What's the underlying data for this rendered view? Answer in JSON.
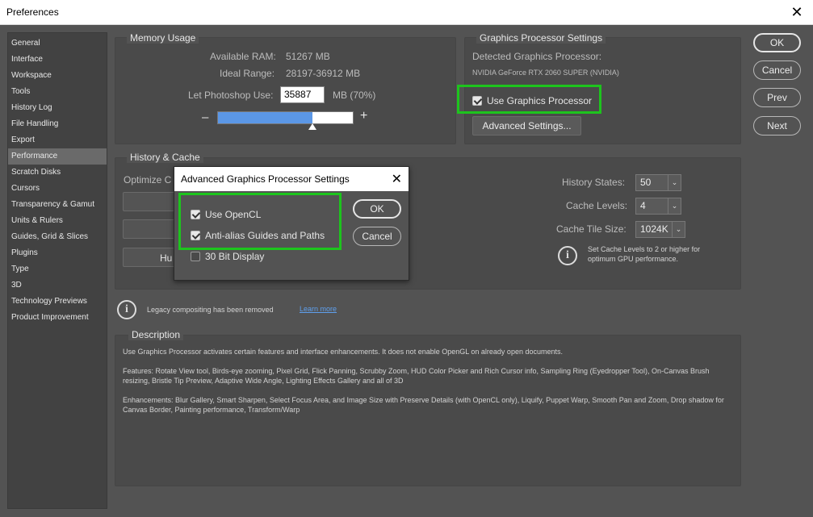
{
  "window": {
    "title": "Preferences",
    "close_glyph": "✕"
  },
  "sidebar": {
    "items": [
      {
        "label": "General"
      },
      {
        "label": "Interface"
      },
      {
        "label": "Workspace"
      },
      {
        "label": "Tools"
      },
      {
        "label": "History Log"
      },
      {
        "label": "File Handling"
      },
      {
        "label": "Export"
      },
      {
        "label": "Performance",
        "active": true
      },
      {
        "label": "Scratch Disks"
      },
      {
        "label": "Cursors"
      },
      {
        "label": "Transparency & Gamut"
      },
      {
        "label": "Units & Rulers"
      },
      {
        "label": "Guides, Grid & Slices"
      },
      {
        "label": "Plugins"
      },
      {
        "label": "Type"
      },
      {
        "label": "3D"
      },
      {
        "label": "Technology Previews"
      },
      {
        "label": "Product Improvement"
      }
    ]
  },
  "memory": {
    "title": "Memory Usage",
    "available_label": "Available RAM:",
    "available_value": "51267 MB",
    "ideal_label": "Ideal Range:",
    "ideal_value": "28197-36912 MB",
    "use_label": "Let Photoshop Use:",
    "use_value": "35887",
    "use_unit": "MB (70%)",
    "minus": "–",
    "plus": "+",
    "fill_percent": 70
  },
  "gpu": {
    "title": "Graphics Processor Settings",
    "detected_label": "Detected Graphics Processor:",
    "detected_value": "NVIDIA GeForce RTX 2060 SUPER (NVIDIA)",
    "use_gpu_label": "Use Graphics Processor",
    "use_gpu_checked": true,
    "advanced_button": "Advanced Settings..."
  },
  "buttons": {
    "ok": "OK",
    "cancel": "Cancel",
    "prev": "Prev",
    "next": "Next"
  },
  "history": {
    "title": "History & Cache",
    "optimize_label": "Optimize C",
    "ghost_button_label": "Hu",
    "history_states_label": "History States:",
    "history_states_value": "50",
    "cache_levels_label": "Cache Levels:",
    "cache_levels_value": "4",
    "cache_tile_label": "Cache Tile Size:",
    "cache_tile_value": "1024K",
    "tip": "Set Cache Levels to 2 or higher for optimum GPU performance."
  },
  "legacy": {
    "text": "Legacy compositing has been removed",
    "link": "Learn more"
  },
  "description": {
    "title": "Description",
    "p1": "Use Graphics Processor activates certain features and interface enhancements. It does not enable OpenGL on already open documents.",
    "p2": "Features: Rotate View tool, Birds-eye zooming, Pixel Grid, Flick Panning, Scrubby Zoom, HUD Color Picker and Rich Cursor info, Sampling Ring (Eyedropper Tool), On-Canvas Brush resizing, Bristle Tip Preview, Adaptive Wide Angle, Lighting Effects Gallery and all of 3D",
    "p3": "Enhancements: Blur Gallery, Smart Sharpen, Select Focus Area, and Image Size with Preserve Details (with OpenCL only), Liquify, Puppet Warp, Smooth Pan and Zoom, Drop shadow for Canvas Border, Painting performance, Transform/Warp"
  },
  "dialog": {
    "title": "Advanced Graphics Processor Settings",
    "close_glyph": "✕",
    "opencl_label": "Use OpenCL",
    "opencl_checked": true,
    "antialias_label": "Anti-alias Guides and Paths",
    "antialias_checked": true,
    "bit30_label": "30 Bit Display",
    "bit30_checked": false,
    "ok": "OK",
    "cancel": "Cancel"
  },
  "colors": {
    "highlight": "#1dc41d",
    "memory_fill": "#5b97e6",
    "link": "#5fa0ee"
  },
  "icons": {
    "info": "info-icon",
    "chevron": "chevron-down-icon"
  }
}
